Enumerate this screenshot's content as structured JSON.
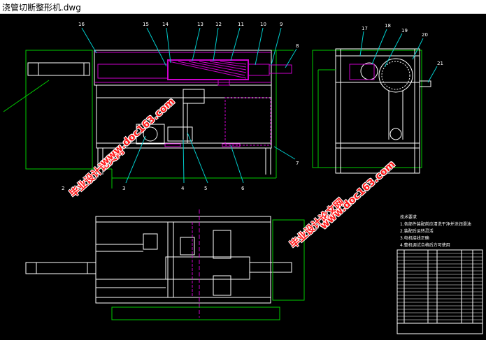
{
  "window": {
    "title": "浇管切断整形机.dwg"
  },
  "drawing": {
    "part_numbers": [
      "16",
      "15",
      "14",
      "13",
      "12",
      "11",
      "10",
      "9",
      "8",
      "7",
      "6",
      "5",
      "4",
      "3",
      "2",
      "17",
      "18",
      "19",
      "20",
      "21"
    ],
    "tech_notes": {
      "heading": "技术要求",
      "lines": [
        "1.各部件装配前应清洗干净并涂润滑油",
        "2.装配后运转灵活",
        "3.电机接线正确",
        "4.整机调试合格后方可使用"
      ]
    }
  },
  "watermarks": [
    {
      "text": "毕业设计论文网"
    },
    {
      "text": "www.doc163.com"
    },
    {
      "text": "毕业设计论文网"
    },
    {
      "text": "www.doc163.com"
    }
  ],
  "colors": {
    "background": "#000000",
    "line": "#ffffff",
    "dimension": "#00cc00",
    "highlight": "#cc00cc",
    "leader": "#00cccc",
    "watermark": "#ff1a1a"
  }
}
